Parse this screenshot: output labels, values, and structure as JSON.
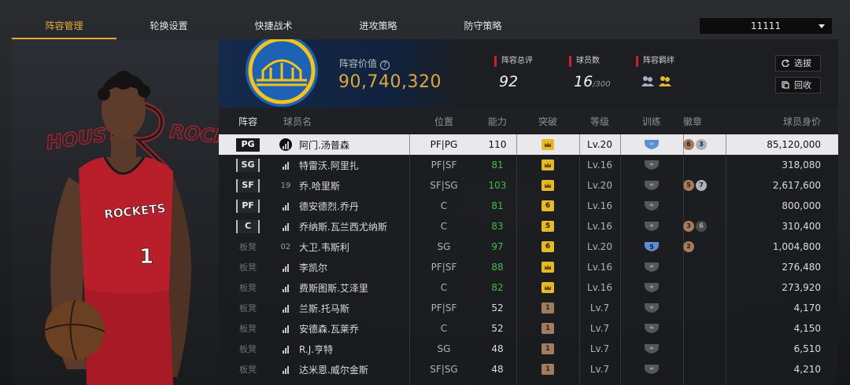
{
  "tabs": [
    {
      "label": "阵容管理",
      "active": true
    },
    {
      "label": "轮换设置",
      "active": false
    },
    {
      "label": "快捷战术",
      "active": false
    },
    {
      "label": "进攻策略",
      "active": false
    },
    {
      "label": "防守策略",
      "active": false
    }
  ],
  "team_select": {
    "value": "11111"
  },
  "player_card": {
    "team_text": "HOUSTON ROCKETS",
    "jersey_text": "ROCKETS",
    "jersey_number": "1"
  },
  "lineup_value": {
    "label": "阵容价值",
    "value": "90,740,320"
  },
  "stats": {
    "overall_label": "阵容总评",
    "overall_value": "92",
    "count_label": "球员数",
    "count_value": "16",
    "count_max": "/300",
    "bond_label": "阵容羁绊"
  },
  "buttons": {
    "filter": "选拔",
    "recycle": "回收"
  },
  "table": {
    "headers": {
      "slot": "阵容",
      "name": "球员名",
      "pos": "位置",
      "ovr": "能力",
      "breakthrough": "突破",
      "level": "等级",
      "training": "训练",
      "badges": "徽章",
      "value": "球员身价"
    },
    "rows": [
      {
        "slot": "PG",
        "starter": true,
        "num": "",
        "icon": "diamond",
        "name": "阿门.汤普森",
        "pos": "PF|PG",
        "ovr": "110",
        "ovr_green": false,
        "brk": "crown",
        "brk_color": "gold",
        "level": "Lv.20",
        "train": "blue",
        "badges": [
          {
            "n": "6",
            "c": "bronze"
          },
          {
            "n": "3",
            "c": "silver"
          }
        ],
        "value": "85,120,000",
        "selected": true
      },
      {
        "slot": "SG",
        "starter": true,
        "num": "",
        "icon": "bars",
        "name": "特雷沃.阿里扎",
        "pos": "PF|SF",
        "ovr": "81",
        "ovr_green": true,
        "brk": "crown",
        "brk_color": "gold",
        "level": "Lv.16",
        "train": "gray",
        "badges": [],
        "value": "318,080",
        "selected": false
      },
      {
        "slot": "SF",
        "starter": true,
        "num": "19",
        "icon": "num",
        "name": "乔.哈里斯",
        "pos": "SF|SG",
        "ovr": "103",
        "ovr_green": true,
        "brk": "crown",
        "brk_color": "gold",
        "level": "Lv.20",
        "train": "gray",
        "badges": [
          {
            "n": "5",
            "c": "bronze"
          },
          {
            "n": "7",
            "c": "silver"
          }
        ],
        "value": "2,617,600",
        "selected": false
      },
      {
        "slot": "PF",
        "starter": true,
        "num": "",
        "icon": "bars",
        "name": "德安德烈.乔丹",
        "pos": "C",
        "ovr": "81",
        "ovr_green": true,
        "brk": "6",
        "brk_color": "gold",
        "level": "Lv.16",
        "train": "gray",
        "badges": [],
        "value": "800,000",
        "selected": false
      },
      {
        "slot": "C",
        "starter": true,
        "num": "",
        "icon": "bars",
        "name": "乔纳斯.瓦兰西尤纳斯",
        "pos": "C",
        "ovr": "83",
        "ovr_green": true,
        "brk": "5",
        "brk_color": "gold",
        "level": "Lv.16",
        "train": "gray",
        "badges": [
          {
            "n": "3",
            "c": "bronze"
          },
          {
            "n": "6",
            "c": "dark"
          }
        ],
        "value": "310,400",
        "selected": false
      },
      {
        "slot": "板凳",
        "starter": false,
        "num": "02",
        "icon": "num",
        "name": "大卫.韦斯利",
        "pos": "SG",
        "ovr": "97",
        "ovr_green": true,
        "brk": "6",
        "brk_color": "gold",
        "level": "Lv.20",
        "train": "blue5",
        "badges": [
          {
            "n": "2",
            "c": "bronze"
          }
        ],
        "value": "1,004,800",
        "selected": false
      },
      {
        "slot": "板凳",
        "starter": false,
        "num": "",
        "icon": "bars",
        "name": "李凯尔",
        "pos": "PF|SF",
        "ovr": "88",
        "ovr_green": true,
        "brk": "crown",
        "brk_color": "gold",
        "level": "Lv.16",
        "train": "gray",
        "badges": [],
        "value": "276,480",
        "selected": false
      },
      {
        "slot": "板凳",
        "starter": false,
        "num": "",
        "icon": "bars",
        "name": "费斯图斯.艾泽里",
        "pos": "C",
        "ovr": "82",
        "ovr_green": true,
        "brk": "crown",
        "brk_color": "gold",
        "level": "Lv.16",
        "train": "gray",
        "badges": [],
        "value": "273,920",
        "selected": false
      },
      {
        "slot": "板凳",
        "starter": false,
        "num": "",
        "icon": "bars",
        "name": "兰斯.托马斯",
        "pos": "PF|SF",
        "ovr": "52",
        "ovr_green": false,
        "brk": "1",
        "brk_color": "bronze",
        "level": "Lv.7",
        "train": "gray",
        "badges": [],
        "value": "4,170",
        "selected": false
      },
      {
        "slot": "板凳",
        "starter": false,
        "num": "",
        "icon": "bars",
        "name": "安德森.瓦莱乔",
        "pos": "C",
        "ovr": "52",
        "ovr_green": false,
        "brk": "1",
        "brk_color": "bronze",
        "level": "Lv.7",
        "train": "gray",
        "badges": [],
        "value": "4,150",
        "selected": false
      },
      {
        "slot": "板凳",
        "starter": false,
        "num": "",
        "icon": "bars",
        "name": "R.J.亨特",
        "pos": "SG",
        "ovr": "48",
        "ovr_green": false,
        "brk": "1",
        "brk_color": "bronze",
        "level": "Lv.7",
        "train": "gray",
        "badges": [],
        "value": "6,510",
        "selected": false
      },
      {
        "slot": "板凳",
        "starter": false,
        "num": "",
        "icon": "bars",
        "name": "达米恩.威尔金斯",
        "pos": "SF|SG",
        "ovr": "48",
        "ovr_green": false,
        "brk": "1",
        "brk_color": "bronze",
        "level": "Lv.7",
        "train": "gray",
        "badges": [],
        "value": "4,210",
        "selected": false
      }
    ]
  },
  "colors": {
    "accent": "#e8a83a",
    "green": "#47b84c",
    "rocket_red": "#c8232c",
    "warriors_blue": "#1d62b5",
    "warriors_gold": "#f4c21c"
  }
}
